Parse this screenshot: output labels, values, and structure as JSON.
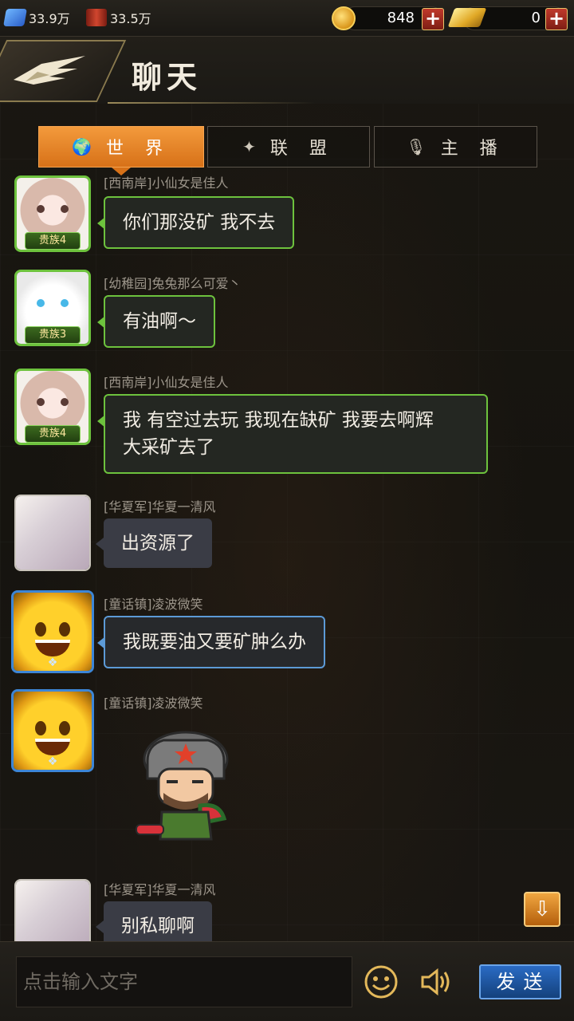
{
  "status": {
    "gems": "33.9万",
    "oil": "33.5万",
    "coins": "848",
    "gold": "0"
  },
  "header": {
    "title": "聊天"
  },
  "tabs": [
    {
      "label": "世 界",
      "icon": "globe-icon",
      "active": true
    },
    {
      "label": "联 盟",
      "icon": "alliance-wings-icon",
      "active": false
    },
    {
      "label": "主 播",
      "icon": "microphone-icon",
      "active": false
    }
  ],
  "messages": [
    {
      "sender": "[西南岸]小仙女是佳人",
      "text": "你们那没矿 我不去",
      "rank": "贵族4",
      "style": "green"
    },
    {
      "sender": "[幼稚园]兔兔那么可爱丶",
      "text": "有油啊～",
      "rank": "贵族3",
      "style": "green"
    },
    {
      "sender": "[西南岸]小仙女是佳人",
      "text_line1": "我 有空过去玩 我现在缺矿 我要去啊辉",
      "text_line2": "大采矿去了",
      "rank": "贵族4",
      "style": "green"
    },
    {
      "sender": "[华夏军]华夏一清风",
      "text": "出资源了",
      "style": "plain"
    },
    {
      "sender": "[童话镇]凌波微笑",
      "text": "我既要油又要矿肿么办",
      "style": "blue"
    },
    {
      "sender": "[童话镇]凌波微笑",
      "sticker": "soldier-eating-watermelon-sticker",
      "style": "blue"
    },
    {
      "sender": "[华夏军]华夏一清风",
      "text": "别私聊啊",
      "style": "plain"
    }
  ],
  "input": {
    "placeholder": "点击输入文字",
    "send_label": "发送"
  },
  "colors": {
    "accent_orange": "#e8841f",
    "noble_green": "#6dc23d",
    "vip_blue": "#3d86d6",
    "send_blue": "#1f5aa6"
  }
}
